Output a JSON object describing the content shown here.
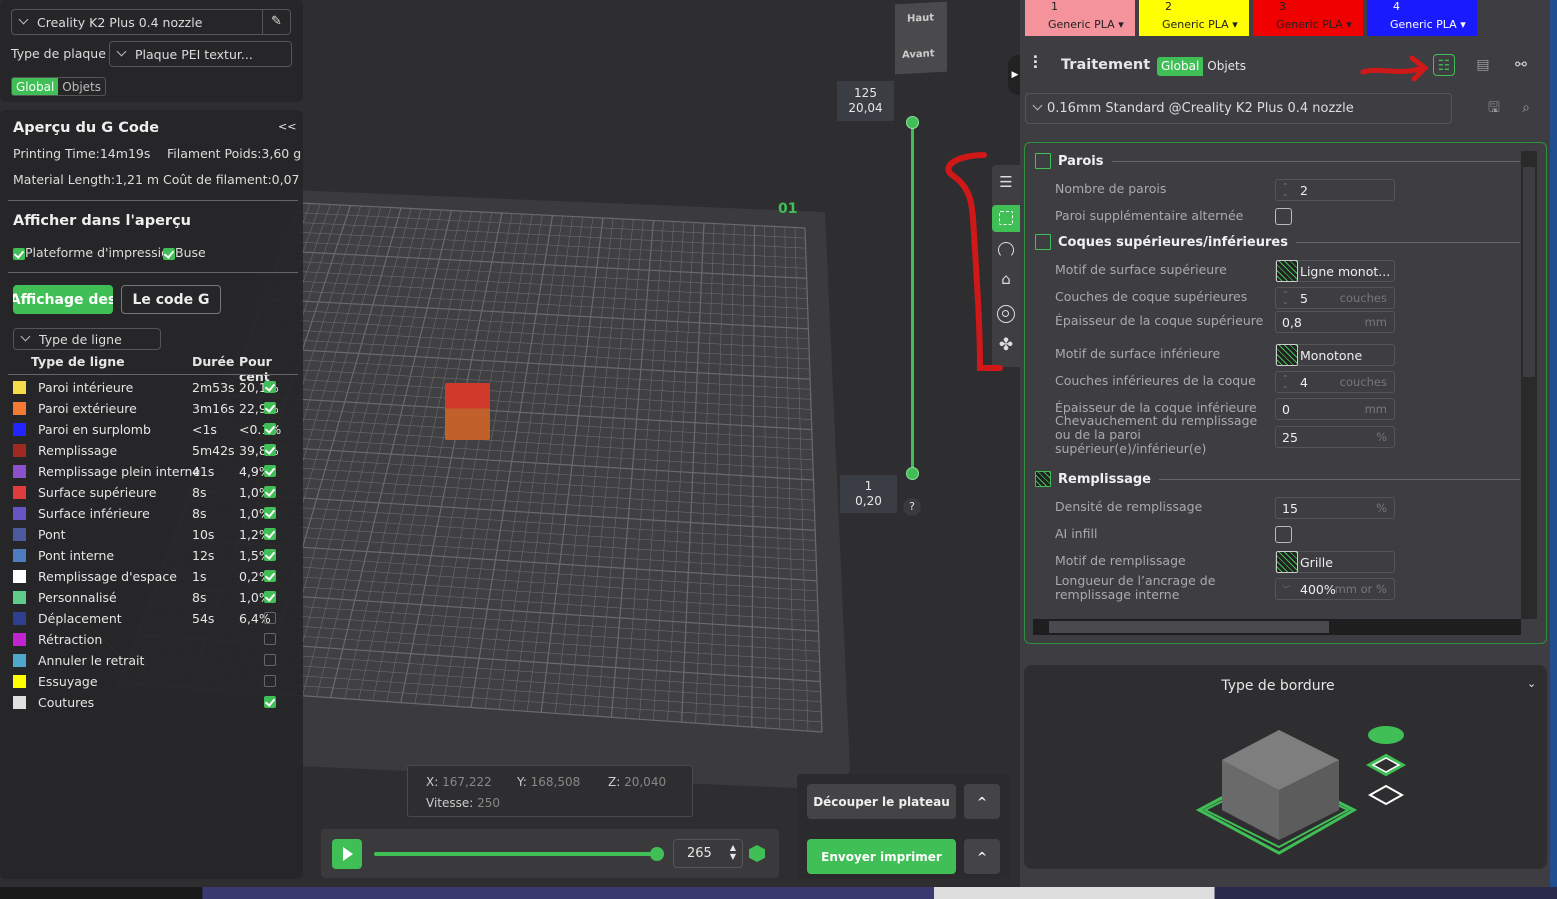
{
  "left_panel": {
    "printer": "Creality K2 Plus 0.4 nozzle",
    "plate_label": "Type de plaque",
    "plate_value": "Plaque PEI textur...",
    "scope_global": "Global",
    "scope_objects": "Objets",
    "preview_title": "Aperçu du G Code",
    "collapse": "<<",
    "printing_time": "Printing Time:14m19s",
    "filament_weight": "Filament Poids:3,60 g",
    "material_length": "Material Length:1,21 m",
    "filament_cost": "Coût de filament:0,07",
    "show_title": "Afficher dans l'aperçu",
    "show_bed": "Plateforme d'impressio",
    "show_nozzle": "Buse",
    "tab_display": "Affichage des",
    "tab_gcode": "Le code G",
    "view_type": "Type de ligne",
    "col_type": "Type de ligne",
    "col_duration": "Durée",
    "col_percent": "Pour cent",
    "legend": [
      {
        "name": "Paroi intérieure",
        "duration": "2m53s",
        "percent": "20,1%",
        "color": "#f5dc48",
        "visible": true
      },
      {
        "name": "Paroi extérieure",
        "duration": "3m16s",
        "percent": "22,9%",
        "color": "#f27a32",
        "visible": true
      },
      {
        "name": "Paroi en surplomb",
        "duration": "<1s",
        "percent": "<0.1%",
        "color": "#2424ff",
        "visible": true
      },
      {
        "name": "Remplissage",
        "duration": "5m42s",
        "percent": "39,8%",
        "color": "#a02a22",
        "visible": true
      },
      {
        "name": "Remplissage plein interne",
        "duration": "41s",
        "percent": "4,9%",
        "color": "#8c50c8",
        "visible": true
      },
      {
        "name": "Surface supérieure",
        "duration": "8s",
        "percent": "1,0%",
        "color": "#e03c3c",
        "visible": true
      },
      {
        "name": "Surface inférieure",
        "duration": "8s",
        "percent": "1,0%",
        "color": "#6656c4",
        "visible": true
      },
      {
        "name": "Pont",
        "duration": "10s",
        "percent": "1,2%",
        "color": "#4a5a9c",
        "visible": true
      },
      {
        "name": "Pont interne",
        "duration": "12s",
        "percent": "1,5%",
        "color": "#4f7cc0",
        "visible": true
      },
      {
        "name": "Remplissage d'espace",
        "duration": "1s",
        "percent": "0,2%",
        "color": "#ffffff",
        "visible": true
      },
      {
        "name": "Personnalisé",
        "duration": "8s",
        "percent": "1,0%",
        "color": "#60cc8c",
        "visible": true
      },
      {
        "name": "Déplacement",
        "duration": "54s",
        "percent": "6,4%",
        "color": "#2f3f90",
        "visible": false
      },
      {
        "name": "Rétraction",
        "duration": "",
        "percent": "",
        "color": "#c024d0",
        "visible": false
      },
      {
        "name": "Annuler le retrait",
        "duration": "",
        "percent": "",
        "color": "#4ea8cc",
        "visible": false
      },
      {
        "name": "Essuyage",
        "duration": "",
        "percent": "",
        "color": "#ffff00",
        "visible": false
      },
      {
        "name": "Coutures",
        "duration": "",
        "percent": "",
        "color": "#e0e0e0",
        "visible": true
      }
    ]
  },
  "viewport": {
    "cube_top": "Haut",
    "cube_front": "Avant",
    "plate_number": "01",
    "layer_top_index": "125",
    "layer_top_height": "20,04",
    "layer_bottom_index": "1",
    "layer_bottom_height": "0,20",
    "help": "?",
    "pos_x_label": "X:",
    "pos_x": "167,222",
    "pos_y_label": "Y:",
    "pos_y": "168,508",
    "pos_z_label": "Z:",
    "pos_z": "20,040",
    "speed_label": "Vitesse:",
    "speed": "250",
    "move_value": "265",
    "move_progress": 1.0,
    "slice_button": "Découper le plateau",
    "print_button": "Envoyer imprimer",
    "expand": "^"
  },
  "right_panel": {
    "filaments": [
      {
        "index": "1",
        "type": "Generic PLA",
        "color": "#f4939c",
        "text": "#222"
      },
      {
        "index": "2",
        "type": "Generic PLA",
        "color": "#ffff00",
        "text": "#222"
      },
      {
        "index": "3",
        "type": "Generic PLA",
        "color": "#f00000",
        "text": "#222"
      },
      {
        "index": "4",
        "type": "Generic PLA",
        "color": "#1a1aff",
        "text": "#fff"
      }
    ],
    "title": "Traitement",
    "scope_global": "Global",
    "scope_objects": "Objets",
    "profile": "0.16mm Standard @Creality K2 Plus 0.4 nozzle",
    "sections": [
      {
        "title": "Parois",
        "rows": [
          {
            "label": "Nombre de parois",
            "type": "spin",
            "value": "2",
            "unit": ""
          },
          {
            "label": "Paroi supplémentaire alternée",
            "type": "check",
            "value": ""
          }
        ]
      },
      {
        "title": "Coques supérieures/inférieures",
        "rows": [
          {
            "label": "Motif de surface supérieure",
            "type": "pattern",
            "value": "Ligne monot..."
          },
          {
            "label": "Couches de coque supérieures",
            "type": "spin",
            "value": "5",
            "unit": "couches"
          },
          {
            "label": "Épaisseur de la coque supérieure",
            "type": "text",
            "value": "0,8",
            "unit": "mm"
          },
          {
            "label": "Motif de surface inférieure",
            "type": "pattern",
            "value": "Monotone"
          },
          {
            "label": "Couches inférieures de la coque",
            "type": "spin",
            "value": "4",
            "unit": "couches"
          },
          {
            "label": "Épaisseur de la coque inférieure",
            "type": "text",
            "value": "0",
            "unit": "mm"
          },
          {
            "label": "Chevauchement du remplissage ou de la paroi supérieur(e)/inférieur(e)",
            "type": "text",
            "value": "25",
            "unit": "%"
          }
        ]
      },
      {
        "title": "Remplissage",
        "rows": [
          {
            "label": "Densité de remplissage",
            "type": "text",
            "value": "15",
            "unit": "%"
          },
          {
            "label": "AI infill",
            "type": "check",
            "value": ""
          },
          {
            "label": "Motif de remplissage",
            "type": "pattern",
            "value": "Grille"
          },
          {
            "label": "Longueur de l’ancrage de remplissage interne",
            "type": "combo",
            "value": "400%",
            "unit": "mm or %"
          }
        ]
      }
    ],
    "brim_title": "Type de bordure"
  }
}
